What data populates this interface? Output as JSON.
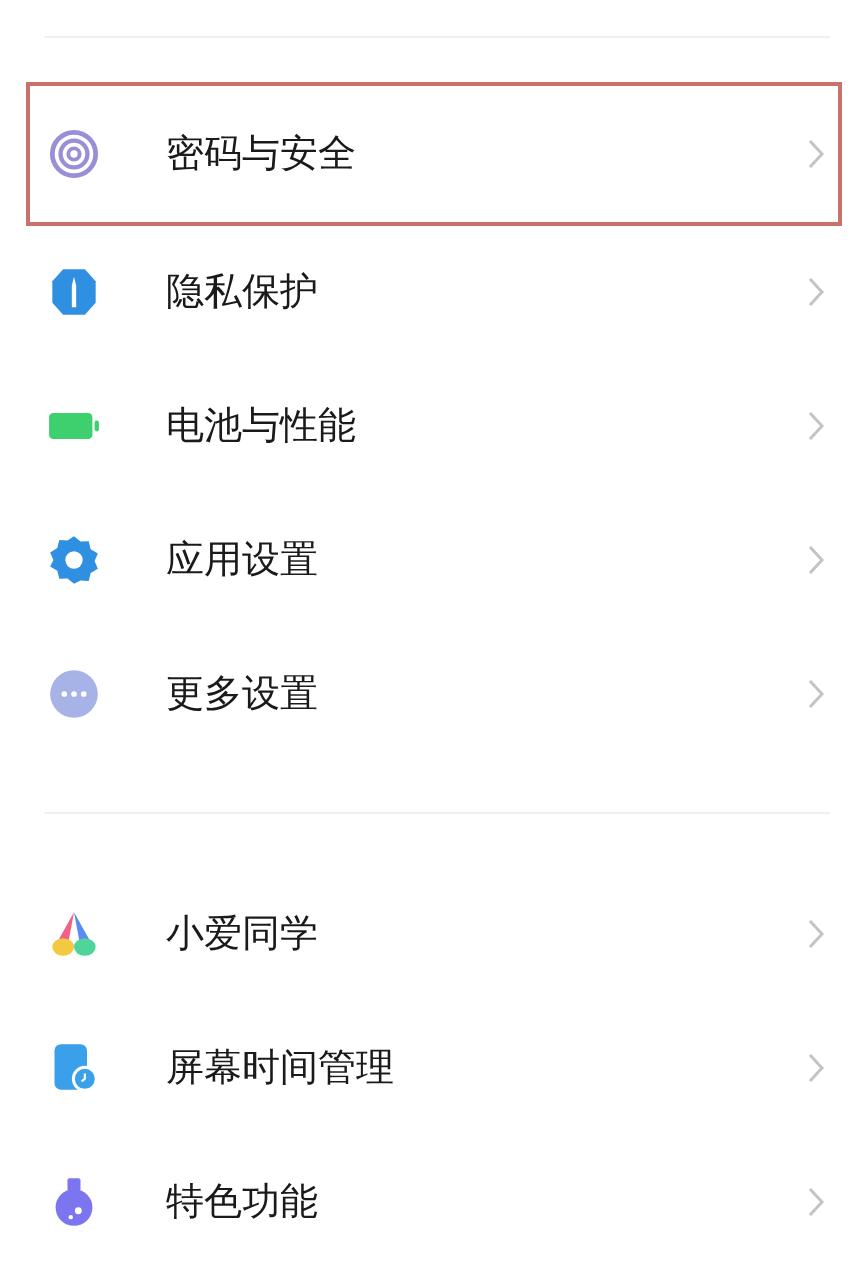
{
  "groups": [
    {
      "items": [
        {
          "kind": "fingerprint",
          "label": "密码与安全",
          "selected": true
        },
        {
          "kind": "shield",
          "label": "隐私保护",
          "selected": false
        },
        {
          "kind": "battery",
          "label": "电池与性能",
          "selected": false
        },
        {
          "kind": "gear",
          "label": "应用设置",
          "selected": false
        },
        {
          "kind": "more",
          "label": "更多设置",
          "selected": false
        }
      ]
    },
    {
      "items": [
        {
          "kind": "assistant",
          "label": "小爱同学",
          "selected": false
        },
        {
          "kind": "screentime",
          "label": "屏幕时间管理",
          "selected": false
        },
        {
          "kind": "flask",
          "label": "特色功能",
          "selected": false
        }
      ]
    }
  ]
}
